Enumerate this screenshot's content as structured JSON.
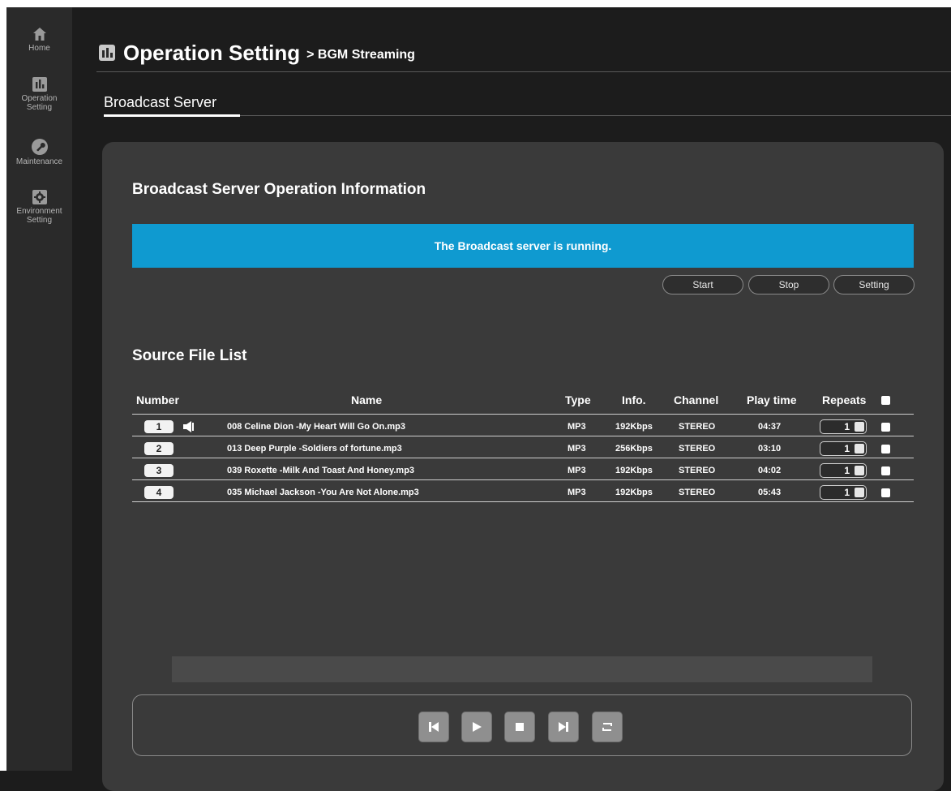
{
  "sidebar": {
    "items": [
      {
        "label": "Home",
        "icon": "home-icon"
      },
      {
        "label": "Operation Setting",
        "icon": "bar-chart-icon"
      },
      {
        "label": "Maintenance",
        "icon": "wrench-icon"
      },
      {
        "label": "Environment Setting",
        "icon": "gear-icon"
      }
    ]
  },
  "header": {
    "title": "Operation Setting",
    "breadcrumb": "> BGM Streaming",
    "tab": "Broadcast Server"
  },
  "operation": {
    "title": "Broadcast Server Operation Information",
    "status": "The Broadcast server is running.",
    "status_color": "#0f9ad0",
    "buttons": {
      "start": "Start",
      "stop": "Stop",
      "setting": "Setting"
    }
  },
  "source_list": {
    "title": "Source File List",
    "columns": {
      "number": "Number",
      "name": "Name",
      "type": "Type",
      "info": "Info.",
      "channel": "Channel",
      "play_time": "Play time",
      "repeats": "Repeats"
    },
    "rows": [
      {
        "number": "1",
        "name": "008 Celine Dion -My Heart Will Go On.mp3",
        "type": "MP3",
        "info": "192Kbps",
        "channel": "STEREO",
        "play_time": "04:37",
        "repeats": "1",
        "playing": true
      },
      {
        "number": "2",
        "name": "013 Deep Purple -Soldiers of fortune.mp3",
        "type": "MP3",
        "info": "256Kbps",
        "channel": "STEREO",
        "play_time": "03:10",
        "repeats": "1",
        "playing": false
      },
      {
        "number": "3",
        "name": "039 Roxette -Milk And Toast And Honey.mp3",
        "type": "MP3",
        "info": "192Kbps",
        "channel": "STEREO",
        "play_time": "04:02",
        "repeats": "1",
        "playing": false
      },
      {
        "number": "4",
        "name": "035 Michael Jackson -You Are Not Alone.mp3",
        "type": "MP3",
        "info": "192Kbps",
        "channel": "STEREO",
        "play_time": "05:43",
        "repeats": "1",
        "playing": false
      }
    ]
  },
  "player": {
    "controls": [
      "previous-icon",
      "play-icon",
      "stop-icon",
      "next-icon",
      "repeat-icon"
    ]
  }
}
